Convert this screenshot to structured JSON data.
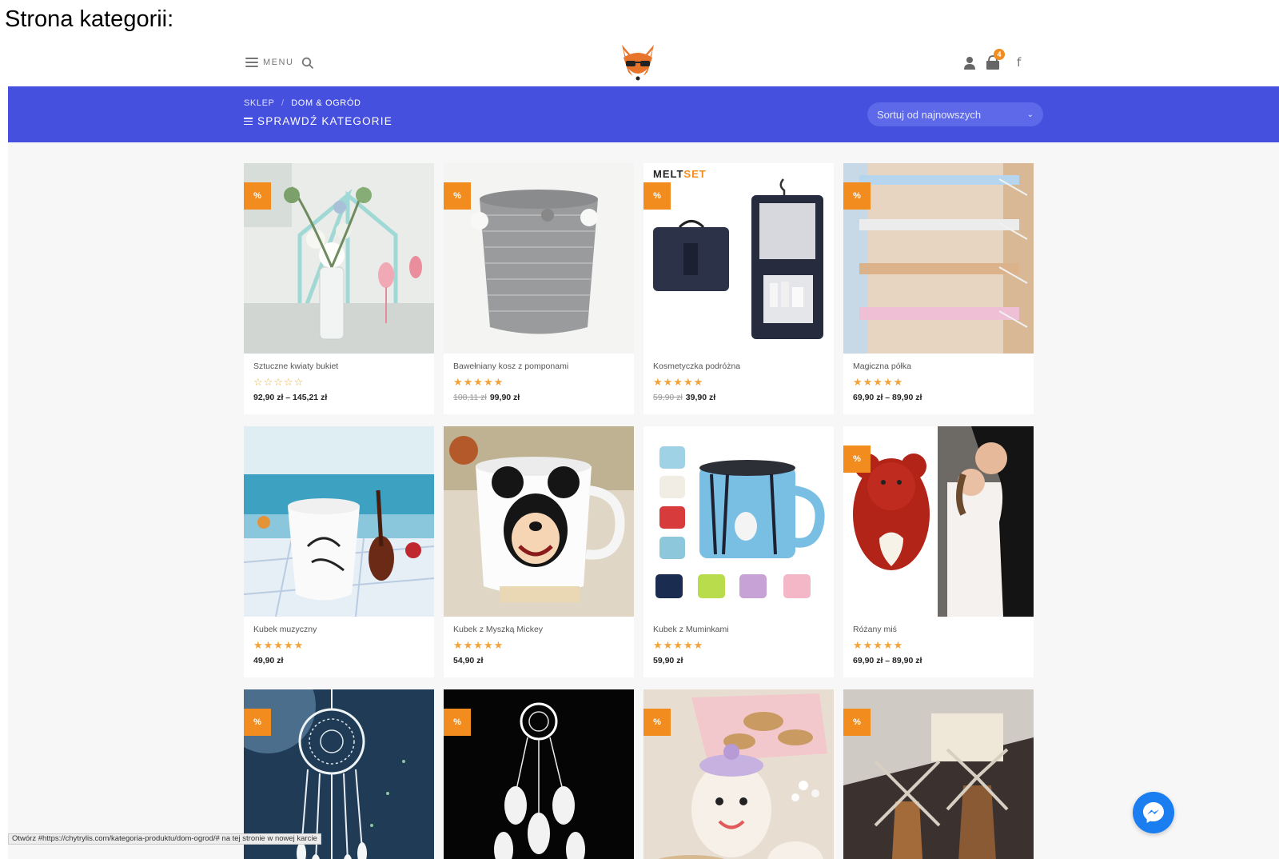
{
  "caption": "Strona kategorii:",
  "header": {
    "menu_label": "MENU",
    "cart_count": "4",
    "facebook_glyph": "f"
  },
  "category_bar": {
    "breadcrumb": [
      "SKLEP",
      "DOM & OGRÓD"
    ],
    "toggle_label": "SPRAWDŹ KATEGORIE",
    "sort_value": "Sortuj od najnowszych"
  },
  "badge_label": "%",
  "brand_mark": {
    "a": "MELT",
    "b": "SET"
  },
  "products": [
    {
      "title": "Sztuczne kwiaty bukiet",
      "rating": 0,
      "old_price": "",
      "price": "92,90 zł – 145,21 zł",
      "badge": true
    },
    {
      "title": "Bawełniany kosz z pomponami",
      "rating": 5,
      "old_price": "108,11 zł",
      "price": "99,90 zł",
      "badge": true
    },
    {
      "title": "Kosmetyczka podróżna",
      "rating": 5,
      "old_price": "59,90 zł",
      "price": "39,90 zł",
      "badge": true
    },
    {
      "title": "Magiczna półka",
      "rating": 5,
      "old_price": "",
      "price": "69,90 zł – 89,90 zł",
      "badge": true
    },
    {
      "title": "Kubek muzyczny",
      "rating": 5,
      "old_price": "",
      "price": "49,90 zł",
      "badge": false
    },
    {
      "title": "Kubek z Myszką Mickey",
      "rating": 5,
      "old_price": "",
      "price": "54,90 zł",
      "badge": false
    },
    {
      "title": "Kubek z Muminkami",
      "rating": 5,
      "old_price": "",
      "price": "59,90 zł",
      "badge": false
    },
    {
      "title": "Różany miś",
      "rating": 5,
      "old_price": "",
      "price": "69,90 zł – 89,90 zł",
      "badge": true
    },
    {
      "title": "",
      "rating": null,
      "old_price": "",
      "price": "",
      "badge": true
    },
    {
      "title": "",
      "rating": null,
      "old_price": "",
      "price": "",
      "badge": true
    },
    {
      "title": "",
      "rating": null,
      "old_price": "",
      "price": "",
      "badge": true
    },
    {
      "title": "",
      "rating": null,
      "old_price": "",
      "price": "",
      "badge": true
    }
  ],
  "status_url": "Otwórz #https://chytrylis.com/kategoria-produktu/dom-ogrod/# na tej stronie w nowej karcie",
  "colors": {
    "category_bar": "#4650df",
    "accent_orange": "#f28c1f",
    "star": "#f2a33a",
    "messenger": "#1a7df0"
  },
  "icons": [
    "hamburger-icon",
    "search-icon",
    "fox-logo",
    "account-icon",
    "cart-icon",
    "facebook-icon",
    "chevron-down-icon",
    "messenger-icon"
  ]
}
